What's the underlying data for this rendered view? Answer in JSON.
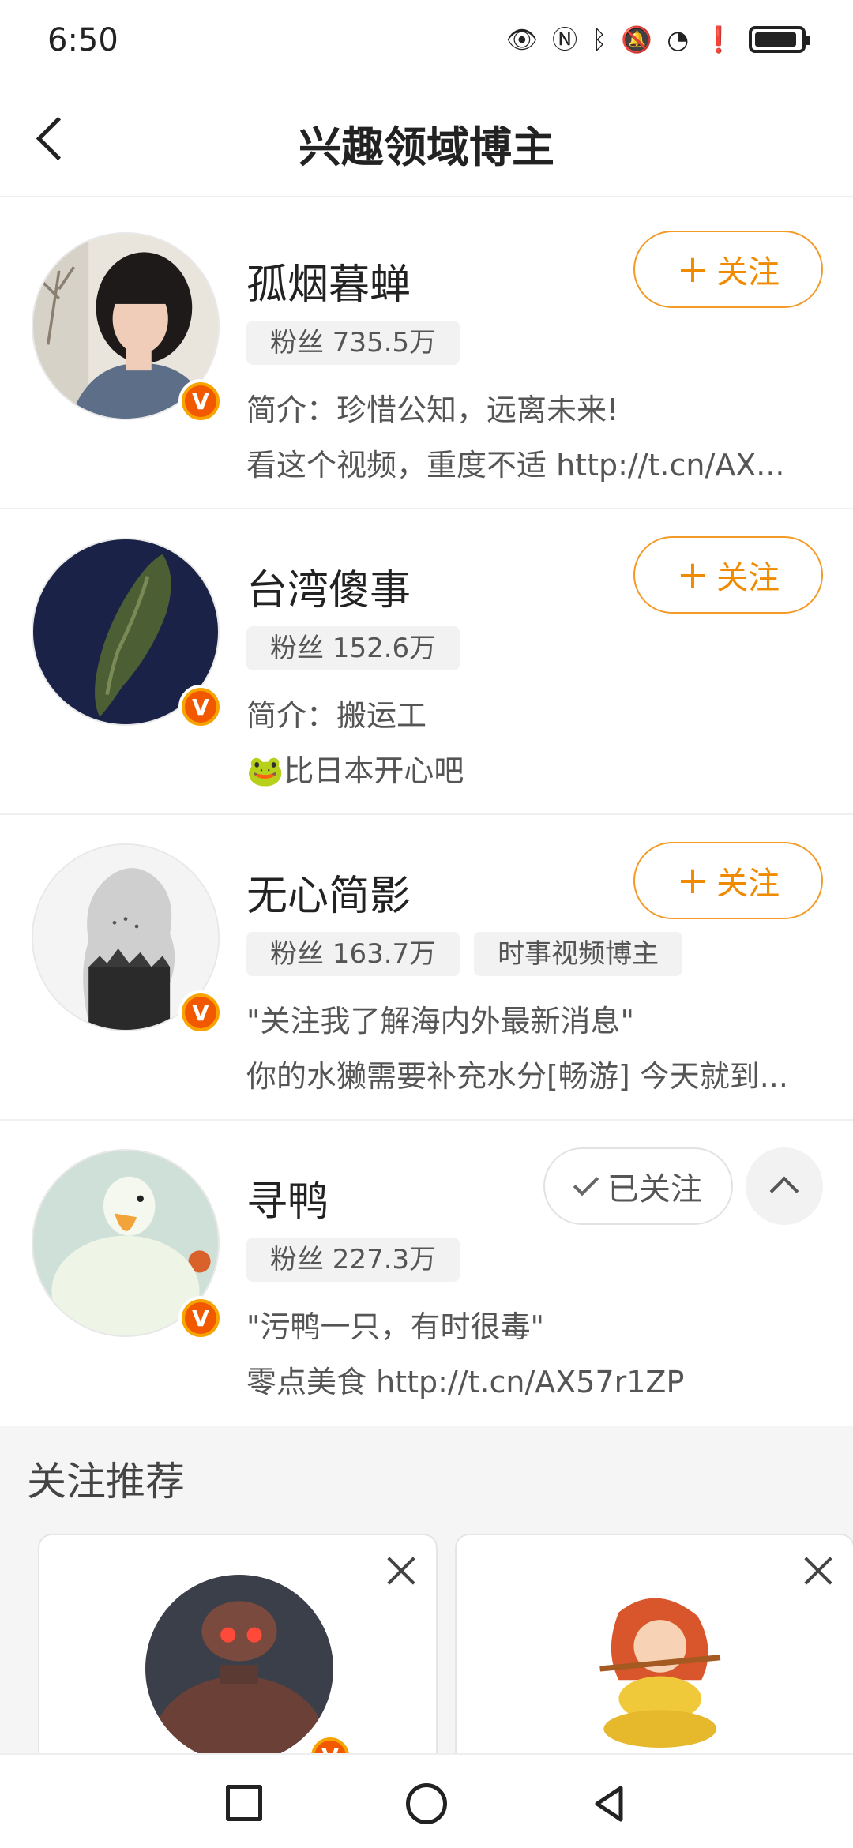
{
  "status_bar": {
    "time": "6:50"
  },
  "header": {
    "title": "兴趣领域博主"
  },
  "bloggers": [
    {
      "name": "孤烟暮蝉",
      "fans": "粉丝 735.5万",
      "category": null,
      "line1": "简介：珍惜公知，远离未来!",
      "line2": "看这个视频，重度不适 http://t.cn/AX...",
      "follow_label": "关注",
      "followed": false
    },
    {
      "name": "台湾傻事",
      "fans": "粉丝 152.6万",
      "category": null,
      "line1": "简介：搬运工",
      "line2": "🐸比日本开心吧",
      "follow_label": "关注",
      "followed": false
    },
    {
      "name": "无心简影",
      "fans": "粉丝 163.7万",
      "category": "时事视频博主",
      "line1": "\"关注我了解海内外最新消息\"",
      "line2": "你的水獭需要补充水分[畅游] 今天就到...",
      "follow_label": "关注",
      "followed": false
    },
    {
      "name": "寻鸭",
      "fans": "粉丝 227.3万",
      "category": null,
      "line1": "\"污鸭一只，有时很毒\"",
      "line2": "零点美食 http://t.cn/AX57r1ZP",
      "follow_label": "已关注",
      "followed": true
    }
  ],
  "recommend": {
    "title": "关注推荐"
  },
  "badge": {
    "letter": "V"
  },
  "colors": {
    "accent": "#f08a00",
    "badge": "#f25800"
  }
}
